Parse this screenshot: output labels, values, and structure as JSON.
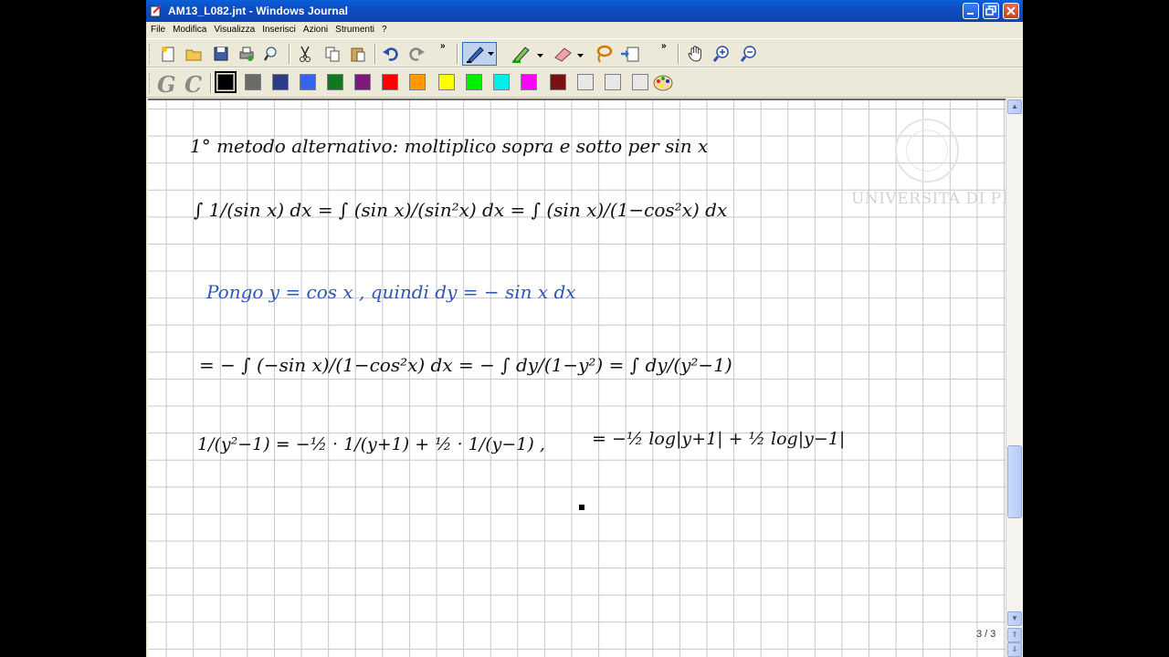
{
  "window": {
    "title": "AM13_L082.jnt - Windows Journal"
  },
  "menu": [
    "File",
    "Modifica",
    "Visualizza",
    "Inserisci",
    "Azioni",
    "Strumenti",
    "?"
  ],
  "toolbar1": {
    "icons": [
      "new-note-icon",
      "open-icon",
      "save-icon",
      "print-icon",
      "find-icon",
      "cut-icon",
      "copy-icon",
      "paste-icon",
      "undo-icon",
      "redo-icon",
      "pen-icon",
      "highlighter-icon",
      "eraser-icon",
      "lasso-icon",
      "insert-space-icon",
      "pan-hand-icon",
      "zoom-in-icon",
      "zoom-out-icon"
    ],
    "chevron": "»"
  },
  "toolbar2": {
    "text_tools": [
      "G",
      "C"
    ],
    "swatches": [
      "#000000",
      "#6b6b6b",
      "#2c3c8c",
      "#3366ee",
      "#0f7a1d",
      "#7a1a7a",
      "#ff0000",
      "#ff9900",
      "#ffff00",
      "#00ee00",
      "#00eeee",
      "#ff00ff",
      "#7a1111",
      "#e8e8e8",
      "#e8e8e8",
      "#e8e8e8"
    ],
    "selected": "#000000"
  },
  "note": {
    "line1": "1° metodo alternativo: moltiplico sopra e sotto per sin x",
    "line2": "∫ 1/(sin x) dx = ∫ (sin x)/(sin²x) dx = ∫ (sin x)/(1−cos²x) dx",
    "line3": "Pongo y = cos x , quindi dy = − sin x dx",
    "line4": "= − ∫ (−sin x)/(1−cos²x) dx = − ∫ dy/(1−y²) = ∫ dy/(y²−1)",
    "line5a": "1/(y²−1) = −½ · 1/(y+1) + ½ · 1/(y−1) ,",
    "line5b": "= −½ log|y+1| + ½ log|y−1|"
  },
  "logo": {
    "name": "UNIVERSITÀ DI PISA"
  },
  "page_indicator": "3 / 3"
}
